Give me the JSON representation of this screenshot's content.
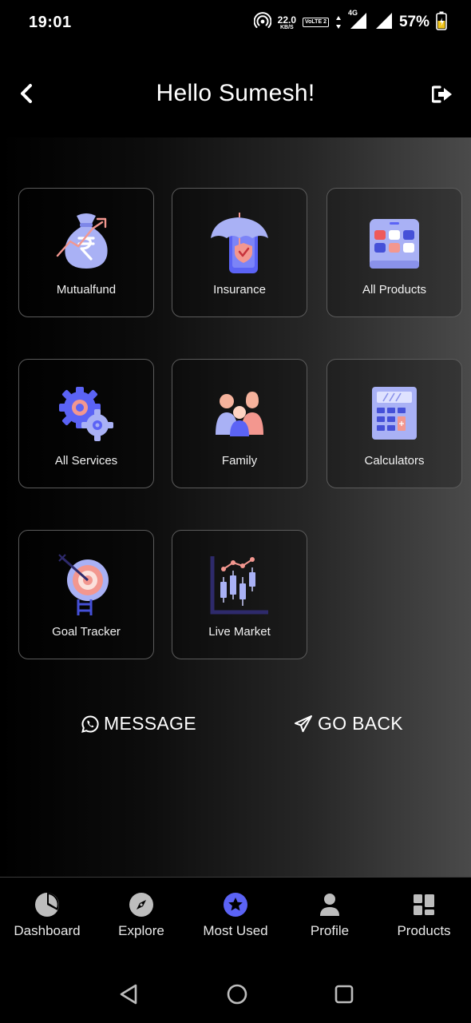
{
  "status_bar": {
    "time": "19:01",
    "net_speed": "22.0",
    "net_unit": "KB/S",
    "volte": "VoLTE 2",
    "network_type": "4G",
    "battery": "57%"
  },
  "header": {
    "title": "Hello Sumesh!"
  },
  "tiles": [
    {
      "label": "Mutualfund",
      "icon": "money-bag-icon"
    },
    {
      "label": "Insurance",
      "icon": "umbrella-shield-icon"
    },
    {
      "label": "All Products",
      "icon": "products-grid-icon"
    },
    {
      "label": "All Services",
      "icon": "gears-icon"
    },
    {
      "label": "Family",
      "icon": "family-icon"
    },
    {
      "label": "Calculators",
      "icon": "calculator-icon"
    },
    {
      "label": "Goal Tracker",
      "icon": "target-icon"
    },
    {
      "label": "Live Market",
      "icon": "candlestick-chart-icon"
    }
  ],
  "actions": {
    "message": "MESSAGE",
    "go_back": "GO BACK"
  },
  "bottom_nav": [
    {
      "label": "Dashboard",
      "icon": "pie-chart-icon"
    },
    {
      "label": "Explore",
      "icon": "compass-icon"
    },
    {
      "label": "Most Used",
      "icon": "star-icon",
      "active": true
    },
    {
      "label": "Profile",
      "icon": "person-icon"
    },
    {
      "label": "Products",
      "icon": "dashboard-blocks-icon"
    }
  ],
  "colors": {
    "accent": "#5b63f5",
    "icon_lavender": "#a9b1f5",
    "icon_coral": "#f3978f",
    "background": "#000000",
    "tile_border": "#5b5b5b"
  }
}
